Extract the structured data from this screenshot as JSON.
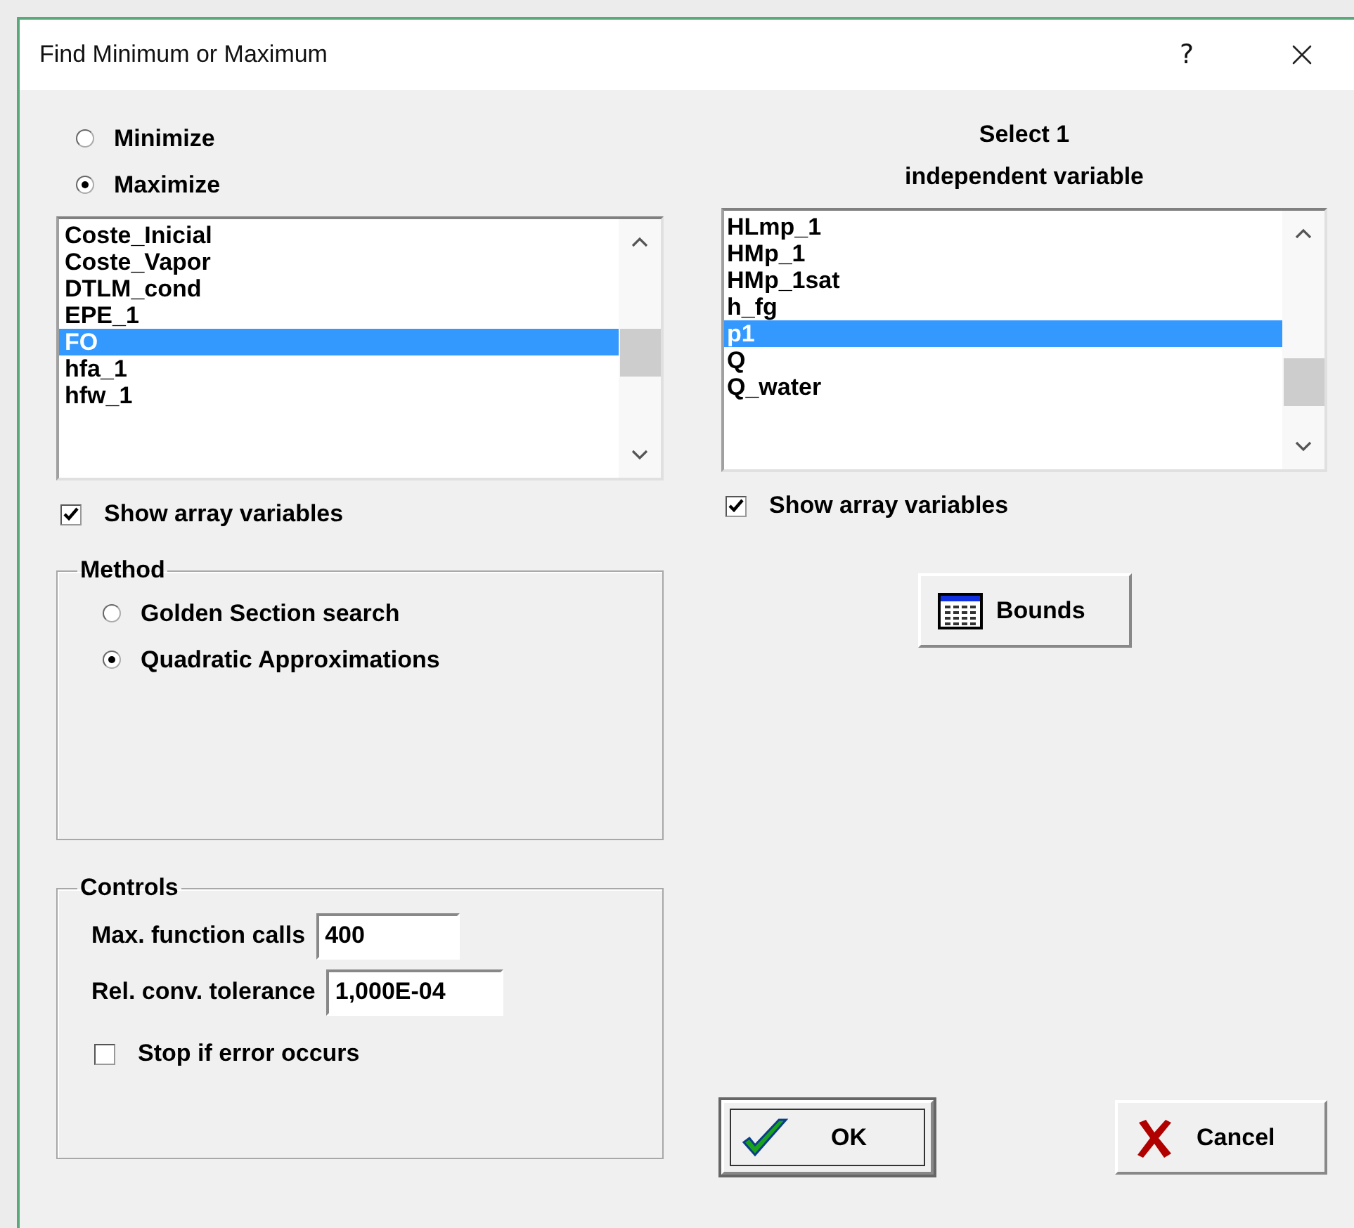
{
  "window": {
    "title": "Find Minimum or Maximum",
    "help_button": "?"
  },
  "goal": [
    {
      "label": "Minimize",
      "selected": false
    },
    {
      "label": "Maximize",
      "selected": true
    }
  ],
  "objective_list": {
    "items": [
      {
        "label": "Coste_Inicial",
        "selected": false
      },
      {
        "label": "Coste_Vapor",
        "selected": false
      },
      {
        "label": "DTLM_cond",
        "selected": false
      },
      {
        "label": "EPE_1",
        "selected": false
      },
      {
        "label": "FO",
        "selected": true
      },
      {
        "label": "hfa_1",
        "selected": false
      },
      {
        "label": "hfw_1",
        "selected": false
      }
    ],
    "show_arrays": {
      "label": "Show array variables",
      "checked": true
    }
  },
  "independent": {
    "heading_lines": [
      "Select 1",
      "independent variable"
    ],
    "items": [
      {
        "label": "HLmp_1",
        "selected": false
      },
      {
        "label": "HMp_1",
        "selected": false
      },
      {
        "label": "HMp_1sat",
        "selected": false
      },
      {
        "label": "h_fg",
        "selected": false
      },
      {
        "label": "p1",
        "selected": true
      },
      {
        "label": "Q",
        "selected": false
      },
      {
        "label": "Q_water",
        "selected": false
      }
    ],
    "show_arrays": {
      "label": "Show array variables",
      "checked": true
    }
  },
  "bounds_button": "Bounds",
  "method": {
    "title": "Method",
    "options": [
      {
        "label": "Golden Section search",
        "selected": false
      },
      {
        "label": "Quadratic Approximations",
        "selected": true
      }
    ]
  },
  "controls": {
    "title": "Controls",
    "fields": [
      {
        "label": "Max. function calls",
        "value": "400"
      },
      {
        "label": "Rel. conv. tolerance",
        "value": "1,000E-04"
      }
    ],
    "stop_on_error": {
      "label": "Stop if error occurs",
      "checked": false
    }
  },
  "buttons": [
    {
      "kind": "ok",
      "label": "OK",
      "focused": true
    },
    {
      "kind": "cancel",
      "label": "Cancel",
      "focused": false
    }
  ]
}
